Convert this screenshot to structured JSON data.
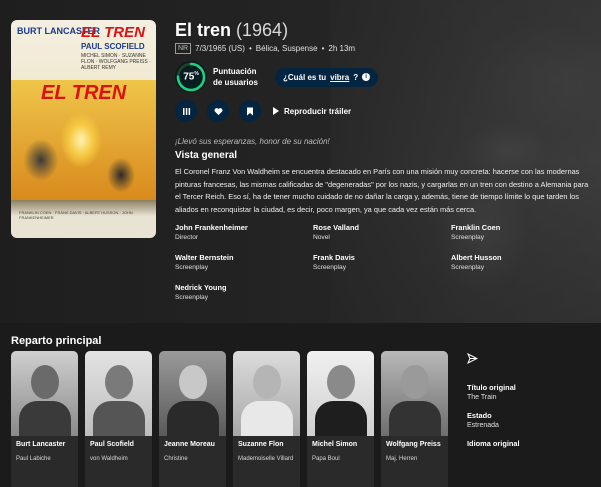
{
  "movie": {
    "title": "El tren",
    "year": "(1964)",
    "certification": "NR",
    "release": "7/3/1965 (US)",
    "separator": "•",
    "genres": "Bélica, Suspense",
    "runtime": "2h 13m",
    "score": "75",
    "score_unit": "%",
    "score_fraction": 0.75,
    "score_label": "Puntuación de usuarios",
    "vibe_prefix": "¿Cuál es tu",
    "vibe_link": "vibra",
    "vibe_suffix": "?",
    "trailer_label": "Reproducir tráiler",
    "tagline": "¡Llevó sus esperanzas, honor de su nación!",
    "overview_heading": "Vista general",
    "overview": "El Coronel Franz Von Waldheim se encuentra destacado en París con una misión muy concreta: hacerse con las modernas pinturas francesas, las mismas calificadas de \"degeneradas\" por los nazis, y cargarlas en un tren con destino a Alemania para el Tercer Reich. Eso sí, ha de tener mucho cuidado de no dañar la carga y, además, tiene de tiempo límite lo que tarden los aliados en reconquistar la ciudad, es decir, poco margen, ya que cada vez están más cerca."
  },
  "poster": {
    "stars": "BURT LANCASTER",
    "title": "EL TREN",
    "costar": "PAUL SCOFIELD",
    "cast_small": "MICHEL SIMON · SUZANNE FLON · WOLFGANG PREISS · ALBERT REMY",
    "big_title": "EL TREN",
    "credits": "FRANKLIN COEN · FRANK DAVIS · ALBERT HUSSON · JOHN FRANKENHEIMER"
  },
  "crew": [
    {
      "name": "John Frankenheimer",
      "job": "Director"
    },
    {
      "name": "Rose Valland",
      "job": "Novel"
    },
    {
      "name": "Franklin Coen",
      "job": "Screenplay"
    },
    {
      "name": "Walter Bernstein",
      "job": "Screenplay"
    },
    {
      "name": "Frank Davis",
      "job": "Screenplay"
    },
    {
      "name": "Albert Husson",
      "job": "Screenplay"
    },
    {
      "name": "Nedrick Young",
      "job": "Screenplay"
    }
  ],
  "cast_heading": "Reparto principal",
  "cast": [
    {
      "name": "Burt Lancaster",
      "role": "Paul Labiche"
    },
    {
      "name": "Paul Scofield",
      "role": "von Waldheim"
    },
    {
      "name": "Jeanne Moreau",
      "role": "Christine"
    },
    {
      "name": "Suzanne Flon",
      "role": "Mademoiselle Villard"
    },
    {
      "name": "Michel Simon",
      "role": "Papa Boul"
    },
    {
      "name": "Wolfgang Preiss",
      "role": "Maj. Herren"
    }
  ],
  "facts": {
    "original_title_label": "Título original",
    "original_title": "The Train",
    "status_label": "Estado",
    "status": "Estrenada",
    "language_label": "Idioma original"
  },
  "colors": {
    "score_ring": "#21d07a",
    "score_track": "#204529",
    "button_bg": "#032541"
  },
  "icons": [
    "list-icon",
    "heart-icon",
    "bookmark-icon",
    "play-icon",
    "info-icon",
    "share-icon"
  ]
}
